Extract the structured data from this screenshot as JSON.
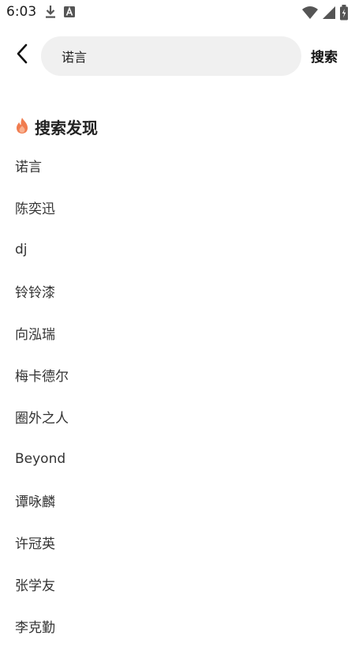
{
  "status_bar": {
    "time": "6:03",
    "left_icons": [
      "download-icon",
      "a-box-icon"
    ],
    "right_icons": [
      "wifi-icon",
      "signal-icon",
      "battery-icon"
    ]
  },
  "header": {
    "back_icon": "chevron-left-icon",
    "search_value": "诺言",
    "search_button_label": "搜索"
  },
  "discover": {
    "title": "搜索发现",
    "title_icon": "flame-icon",
    "accent_color": "#f07c4f",
    "items": [
      {
        "label": "诺言"
      },
      {
        "label": "陈奕迅"
      },
      {
        "label": "dj"
      },
      {
        "label": "铃铃漆"
      },
      {
        "label": "向泓瑞"
      },
      {
        "label": "梅卡德尔"
      },
      {
        "label": "圈外之人"
      },
      {
        "label": "Beyond"
      },
      {
        "label": "谭咏麟"
      },
      {
        "label": "许冠英"
      },
      {
        "label": "张学友"
      },
      {
        "label": "李克勤"
      }
    ]
  }
}
